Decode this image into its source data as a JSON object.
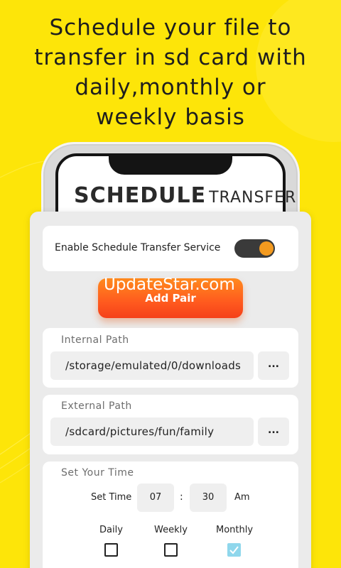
{
  "headline": [
    "Schedule your file to",
    "transfer in sd card with",
    "daily,monthly or",
    "weekly basis"
  ],
  "screen": {
    "title_bold": "SCHEDULE",
    "title_light": "TRANSFER"
  },
  "toggle": {
    "label": "Enable Schedule Transfer Service",
    "enabled": true,
    "on_color": "#f39a1f"
  },
  "add_pair": {
    "label": "Add Pair"
  },
  "watermark": "UpdateStar.com",
  "internal_path": {
    "label": "Internal Path",
    "value": "/storage/emulated/0/downloads",
    "browse_label": "..."
  },
  "external_path": {
    "label": "External Path",
    "value": "/sdcard/pictures/fun/family",
    "browse_label": "..."
  },
  "time": {
    "section_title": "Set Your Time",
    "set_time_label": "Set Time",
    "hour": "07",
    "separator": ":",
    "minute": "30",
    "ampm": "Am",
    "frequencies": [
      {
        "label": "Daily",
        "checked": false
      },
      {
        "label": "Weekly",
        "checked": false
      },
      {
        "label": "Monthly",
        "checked": true
      }
    ]
  },
  "colors": {
    "background": "#fde509",
    "accent": "#ff6a1e"
  }
}
